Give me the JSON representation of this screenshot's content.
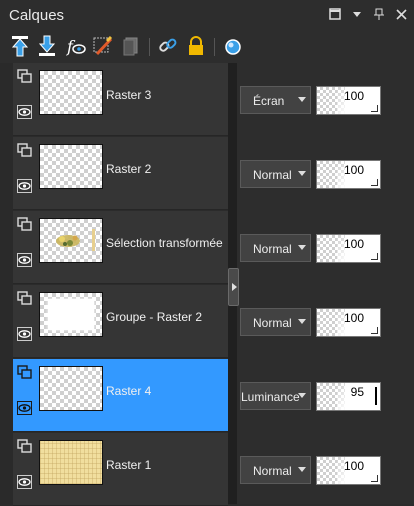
{
  "panel": {
    "title": "Calques"
  },
  "window_controls": [
    {
      "name": "maximize-icon",
      "glyph": "☐"
    },
    {
      "name": "dropdown-icon",
      "glyph": "▾"
    },
    {
      "name": "pin-icon",
      "glyph": "⊥"
    },
    {
      "name": "close-icon",
      "glyph": "✕"
    }
  ],
  "toolbar": {
    "buttons": [
      "move-layer-up-icon",
      "move-layer-down-icon",
      "new-layer-icon",
      "properties-icon",
      "delete-layer-icon",
      "link-icon",
      "lock-icon",
      "mask-icon"
    ]
  },
  "layers": [
    {
      "name": "Raster 3",
      "blend": "Écran",
      "opacity": "100",
      "thumbnail": "transparent",
      "selected": false
    },
    {
      "name": "Raster 2",
      "blend": "Normal",
      "opacity": "100",
      "thumbnail": "transparent",
      "selected": false
    },
    {
      "name": "Sélection transformée",
      "blend": "Normal",
      "opacity": "100",
      "thumbnail": "image",
      "selected": false
    },
    {
      "name": "Groupe - Raster 2",
      "blend": "Normal",
      "opacity": "100",
      "thumbnail": "white-frame",
      "selected": false
    },
    {
      "name": "Raster 4",
      "blend": "Luminance",
      "opacity": "95",
      "thumbnail": "transparent",
      "selected": true
    },
    {
      "name": "Raster 1",
      "blend": "Normal",
      "opacity": "100",
      "thumbnail": "beige",
      "selected": false
    }
  ],
  "colors": {
    "selection": "#3399ff",
    "background": "#2b2b2b",
    "row": "#353535"
  }
}
